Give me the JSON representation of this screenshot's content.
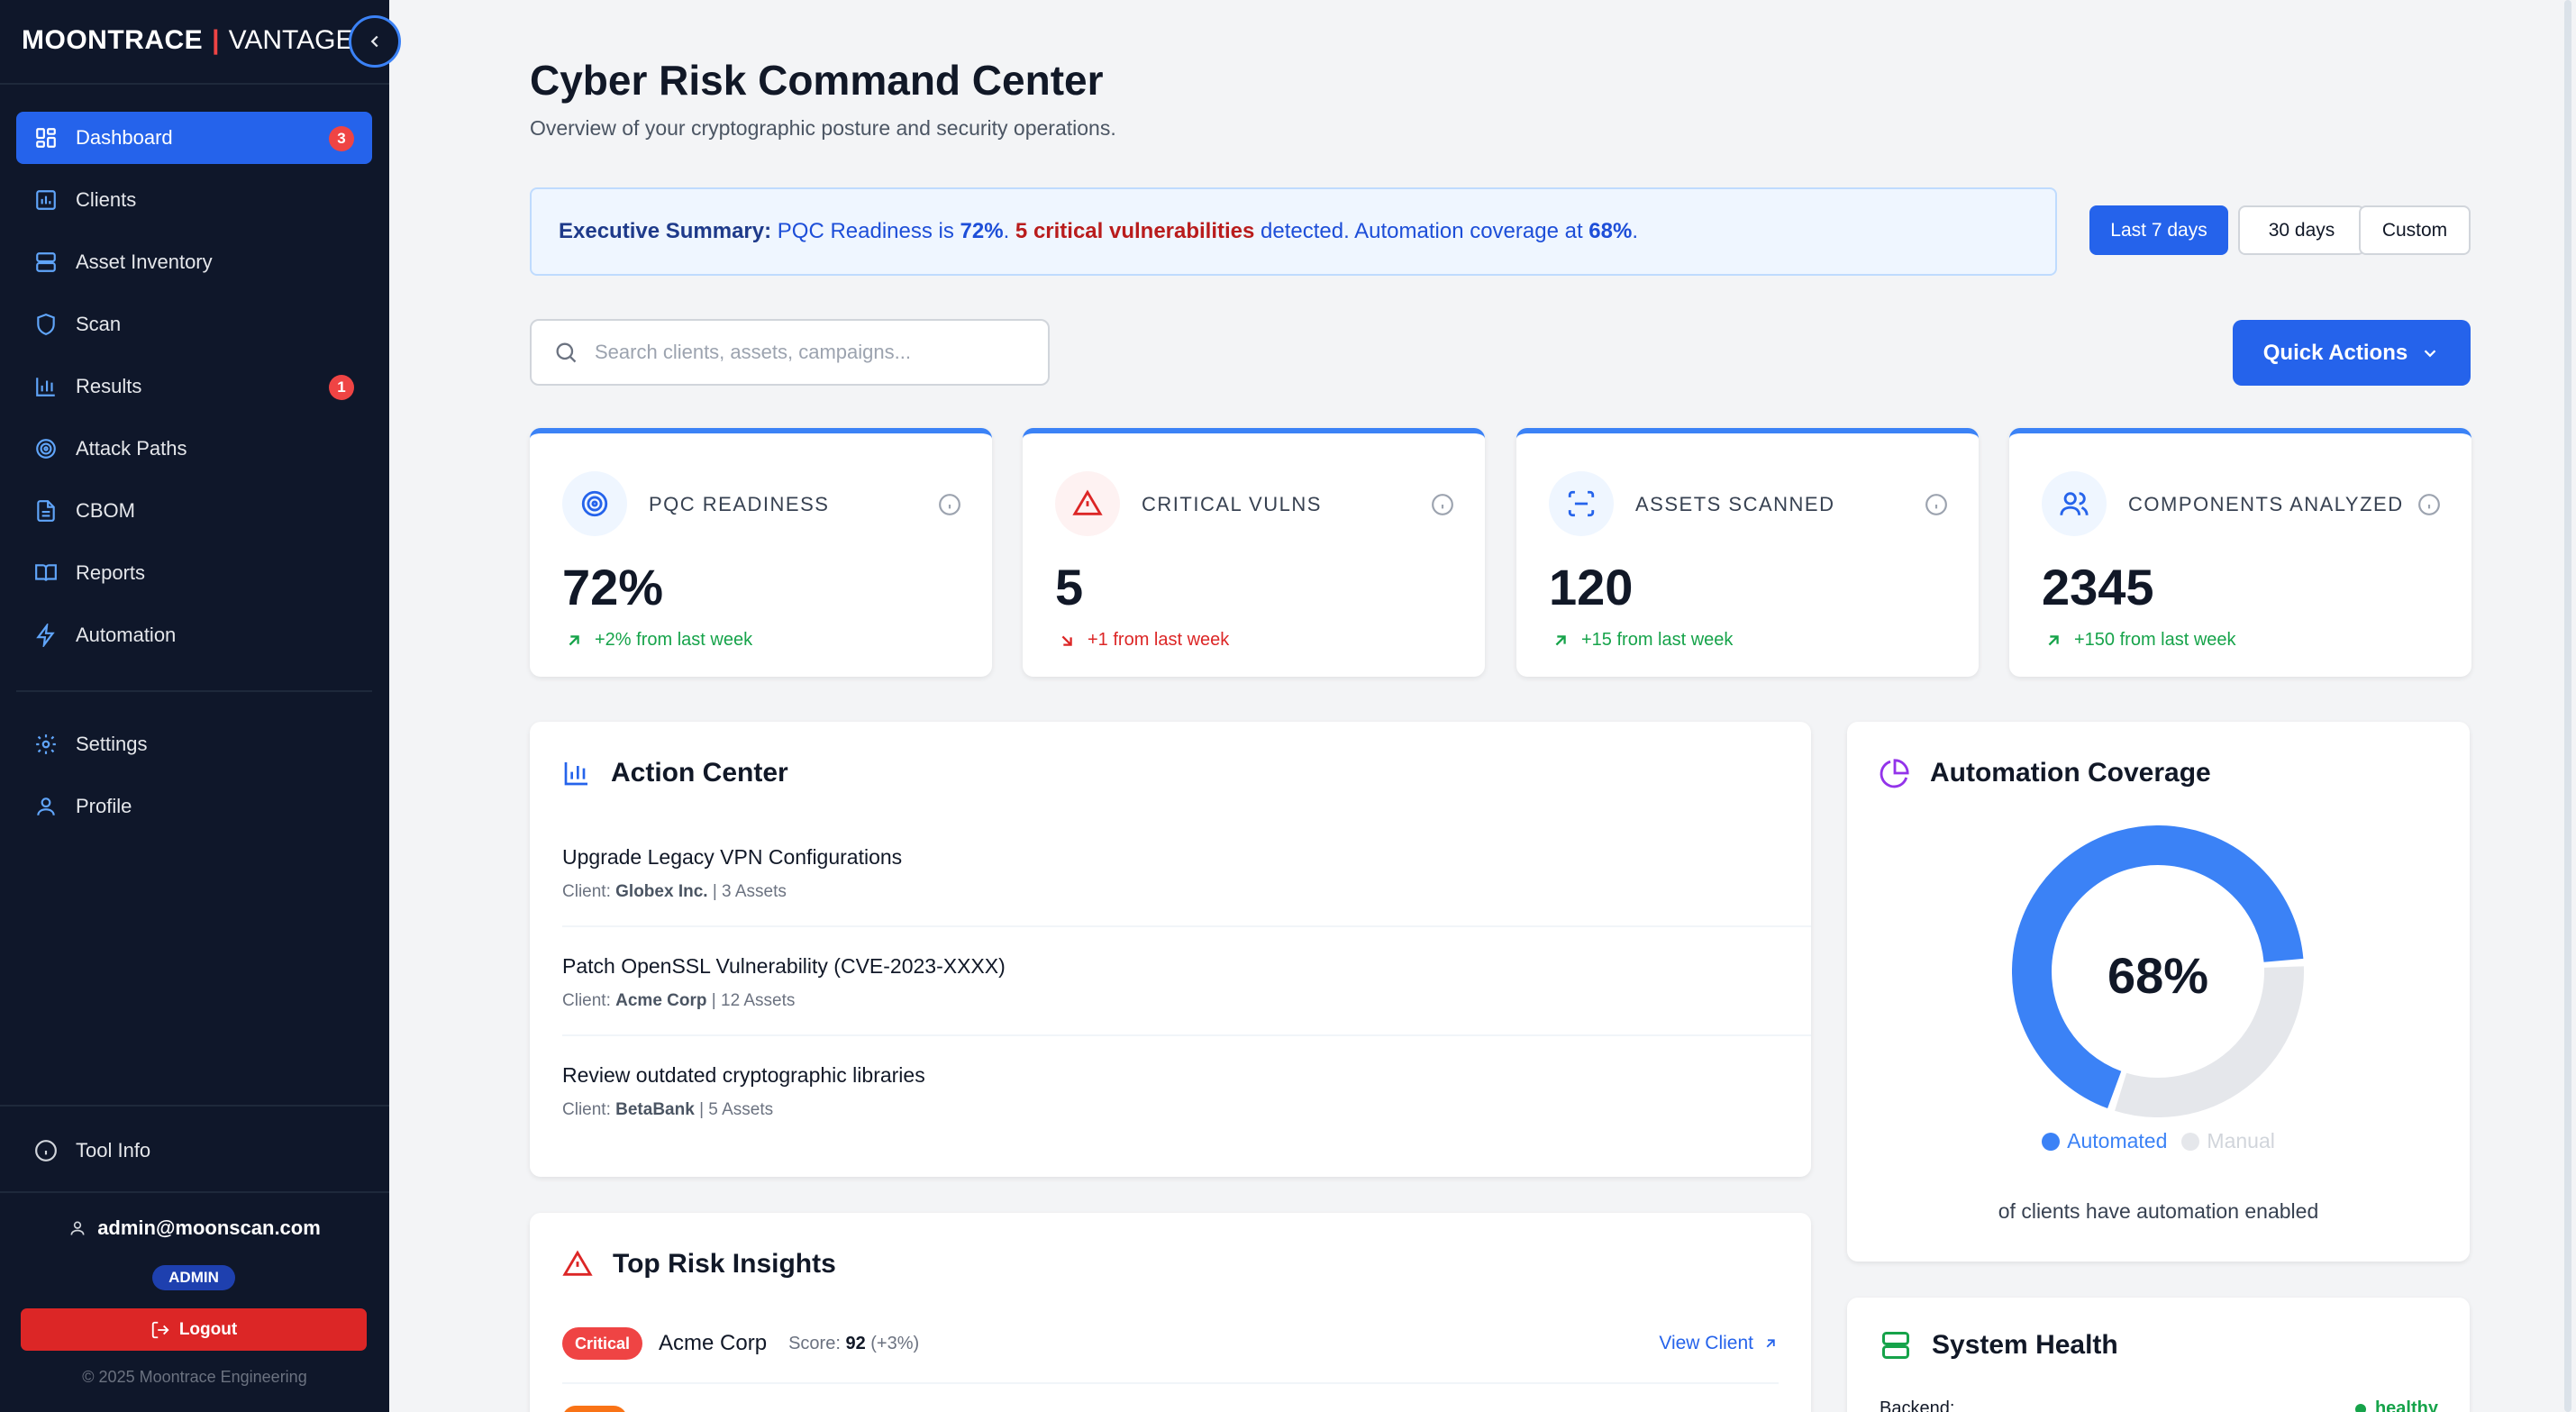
{
  "brand": {
    "name_bold": "MOONTRACE",
    "separator": "|",
    "name_light": "VANTAGE"
  },
  "sidebar": {
    "items": [
      {
        "label": "Dashboard",
        "icon": "grid-icon",
        "badge": "3",
        "active": true
      },
      {
        "label": "Clients",
        "icon": "chart-panel-icon"
      },
      {
        "label": "Asset Inventory",
        "icon": "server-icon"
      },
      {
        "label": "Scan",
        "icon": "shield-icon"
      },
      {
        "label": "Results",
        "icon": "bar-chart-icon",
        "badge": "1"
      },
      {
        "label": "Attack Paths",
        "icon": "target-icon"
      },
      {
        "label": "CBOM",
        "icon": "document-icon"
      },
      {
        "label": "Reports",
        "icon": "book-icon"
      },
      {
        "label": "Automation",
        "icon": "lightning-icon"
      }
    ],
    "secondary": [
      {
        "label": "Settings",
        "icon": "gear-icon"
      },
      {
        "label": "Profile",
        "icon": "user-icon"
      }
    ],
    "tool_info": "Tool Info",
    "user_email": "admin@moonscan.com",
    "role": "ADMIN",
    "logout": "Logout",
    "copyright": "© 2025 Moontrace Engineering"
  },
  "header": {
    "title": "Cyber Risk Command Center",
    "subtitle": "Overview of your cryptographic posture and security operations."
  },
  "executive_summary": {
    "label": "Executive Summary:",
    "text1": "PQC Readiness is",
    "pqc": "72%",
    "text2": ".",
    "critical": "5 critical vulnerabilities",
    "text3": "detected. Automation coverage at",
    "automation": "68%",
    "text4": "."
  },
  "range_buttons": [
    {
      "label": "Last 7 days",
      "active": true
    },
    {
      "label": "30 days"
    },
    {
      "label": "Custom"
    }
  ],
  "search": {
    "placeholder": "Search clients, assets, campaigns...",
    "value": ""
  },
  "quick_actions": {
    "label": "Quick Actions"
  },
  "kpis": [
    {
      "label": "PQC READINESS",
      "value": "72%",
      "delta": "+2% from last week",
      "trend": "up",
      "icon": "target-icon"
    },
    {
      "label": "CRITICAL VULNS",
      "value": "5",
      "delta": "+1 from last week",
      "trend": "down",
      "icon": "warning-icon"
    },
    {
      "label": "ASSETS SCANNED",
      "value": "120",
      "delta": "+15 from last week",
      "trend": "up",
      "icon": "scan-icon"
    },
    {
      "label": "COMPONENTS ANALYZED",
      "value": "2345",
      "delta": "+150 from last week",
      "trend": "up",
      "icon": "users-icon"
    }
  ],
  "action_center": {
    "title": "Action Center",
    "items": [
      {
        "title": "Upgrade Legacy VPN Configurations",
        "client_label": "Client:",
        "client": "Globex Inc.",
        "assets": "| 3 Assets"
      },
      {
        "title": "Patch OpenSSL Vulnerability (CVE-2023-XXXX)",
        "client_label": "Client:",
        "client": "Acme Corp",
        "assets": "| 12 Assets"
      },
      {
        "title": "Review outdated cryptographic libraries",
        "client_label": "Client:",
        "client": "BetaBank",
        "assets": "| 5 Assets"
      }
    ]
  },
  "automation_coverage": {
    "title": "Automation Coverage",
    "value_label": "68%",
    "automated_fraction": 0.68,
    "legend_automated": "Automated",
    "legend_manual": "Manual",
    "note": "of clients have automation enabled",
    "colors": {
      "automated": "#3b82f6",
      "manual": "#e5e7eb"
    }
  },
  "top_risk": {
    "title": "Top Risk Insights",
    "rows": [
      {
        "severity": "Critical",
        "client": "Acme Corp",
        "score_label": "Score:",
        "score": "92",
        "change": "(+3%)",
        "link": "View Client"
      }
    ]
  },
  "system_health": {
    "title": "System Health",
    "rows": [
      {
        "name": "Backend:",
        "status": "healthy"
      }
    ]
  }
}
